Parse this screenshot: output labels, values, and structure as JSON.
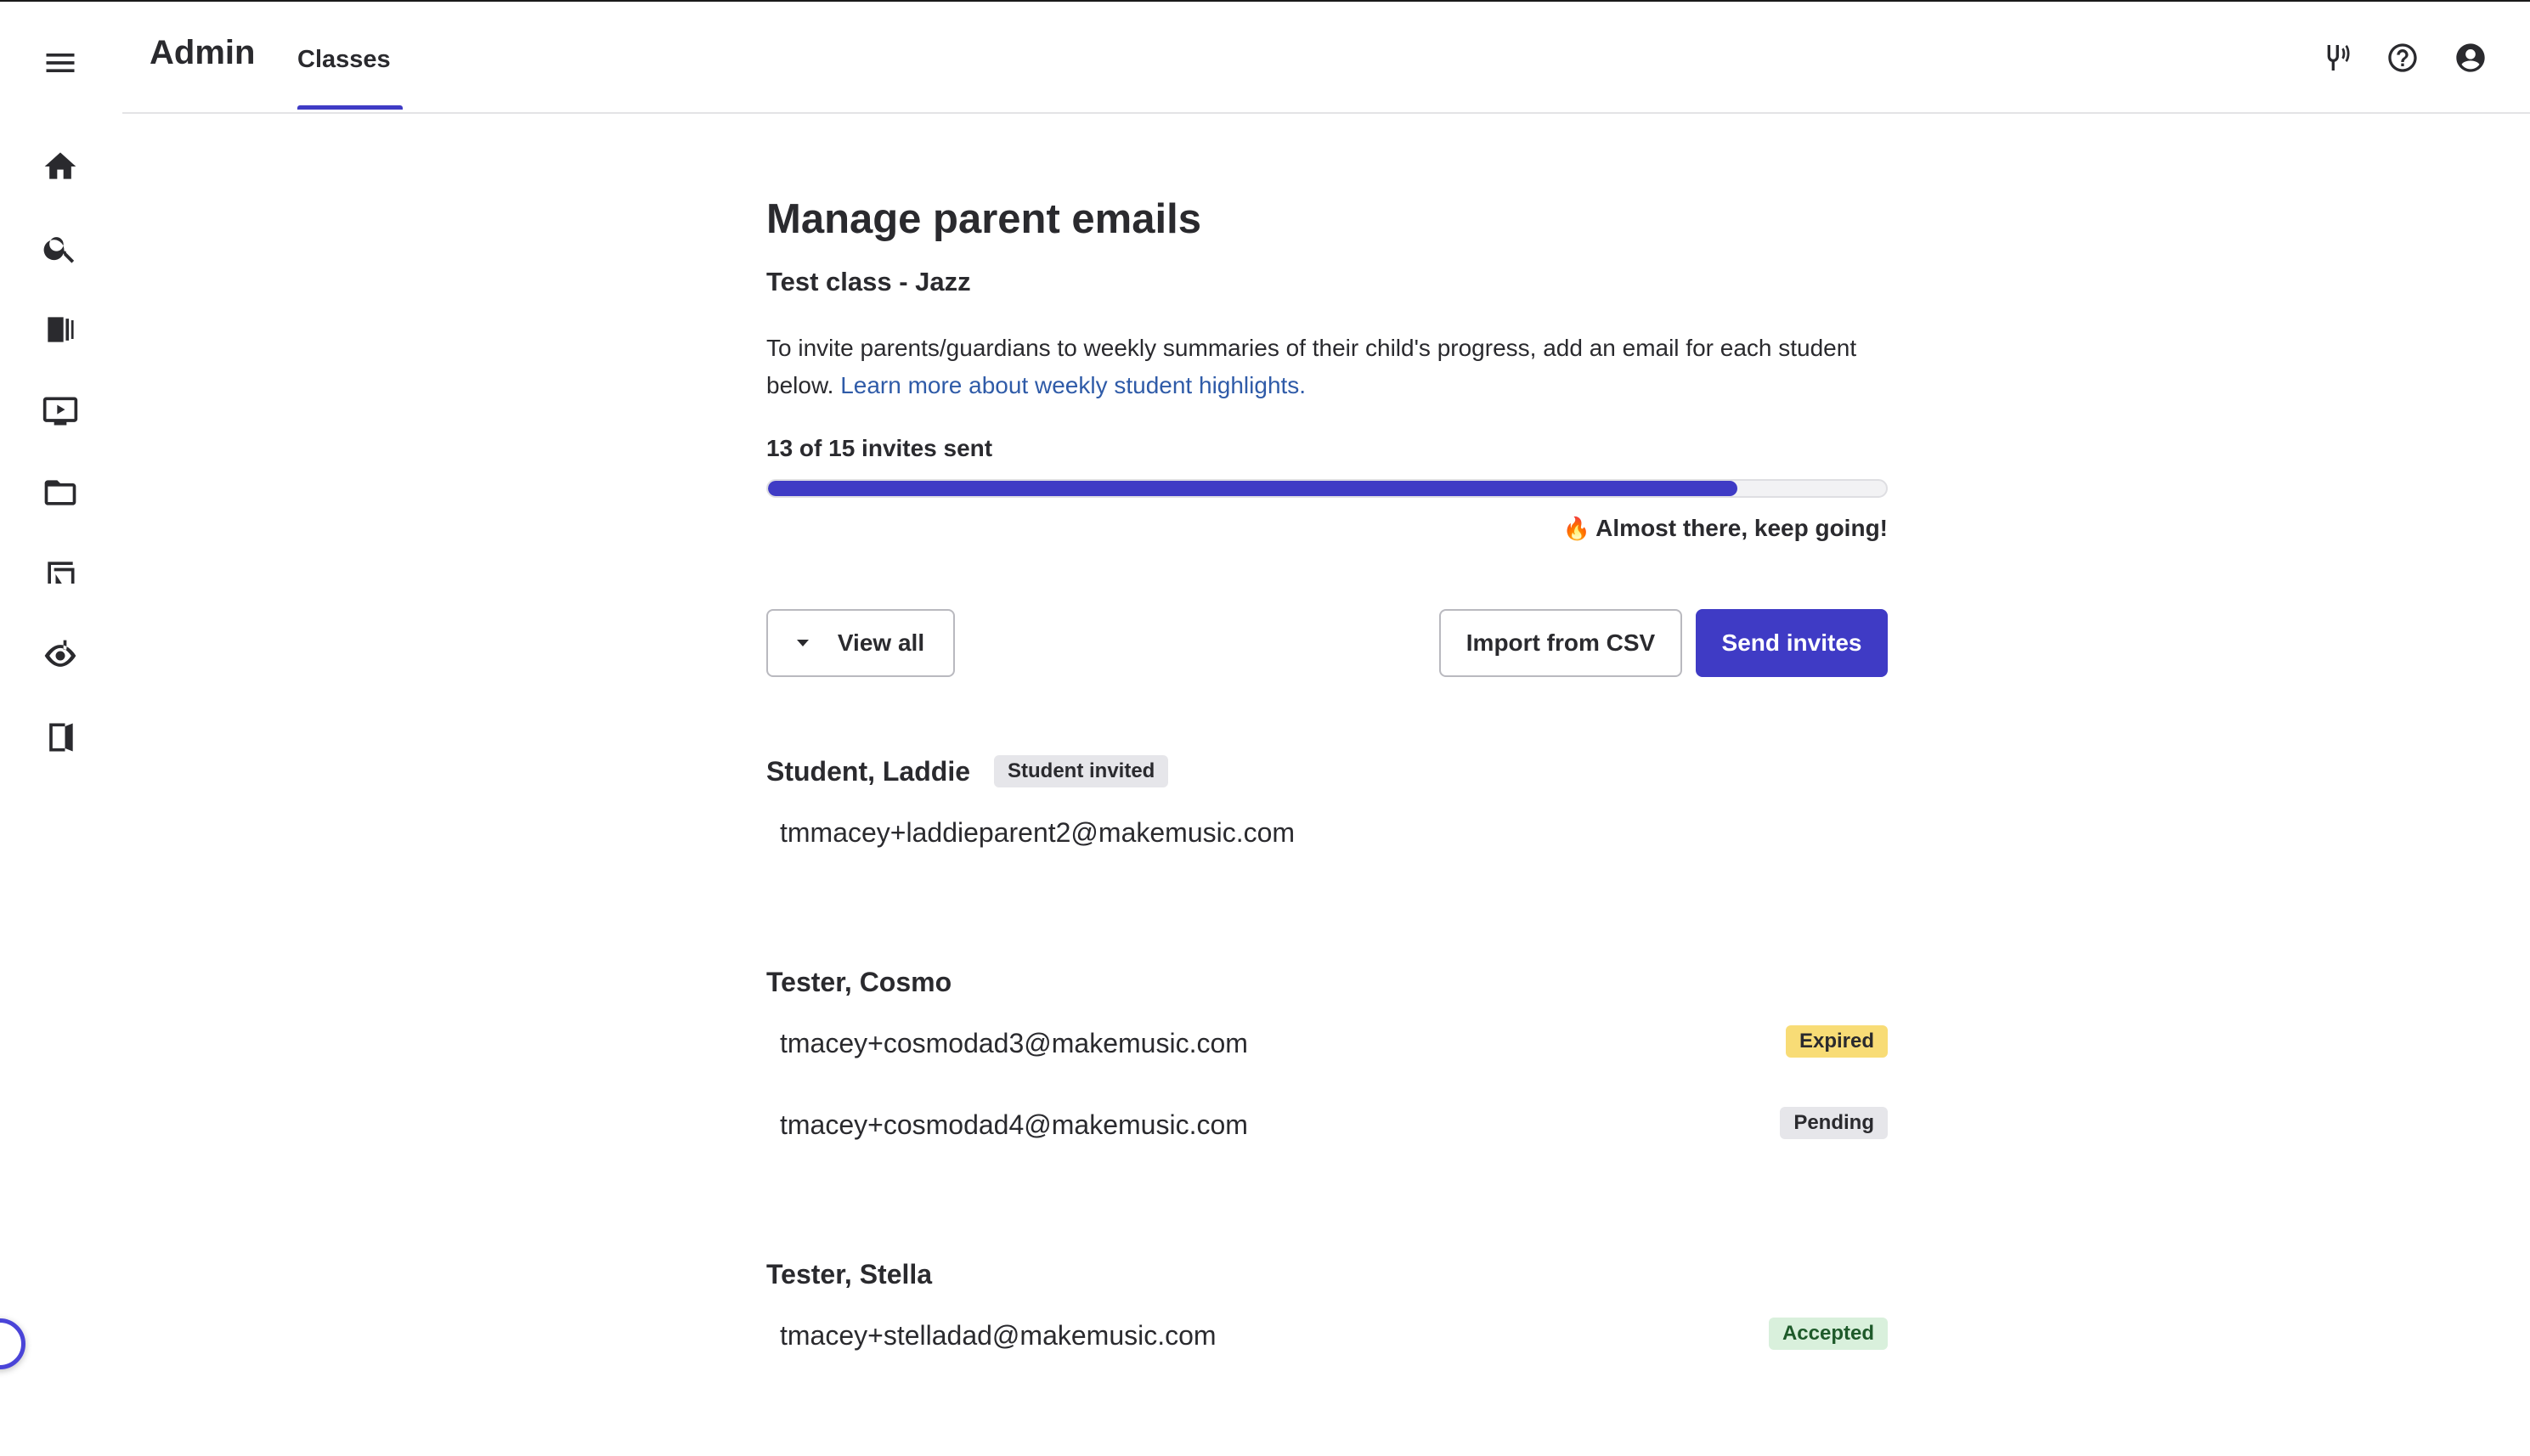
{
  "header": {
    "app_title": "Admin",
    "tabs": [
      {
        "label": "Classes",
        "active": true
      }
    ],
    "icons": [
      "tuning-fork-icon",
      "help-icon",
      "account-icon"
    ]
  },
  "sidebar": {
    "icons": [
      "menu-icon",
      "home-icon",
      "search-icon",
      "library-icon",
      "video-icon",
      "folder-icon",
      "assignment-icon",
      "ear-music-icon",
      "exit-icon"
    ]
  },
  "main": {
    "title": "Manage parent emails",
    "subtitle": "Test class - Jazz",
    "description": "To invite parents/guardians to weekly summaries of their child's progress, add an email for each student below.",
    "learn_more_link": "Learn more about weekly student highlights.",
    "progress": {
      "label": "13 of 15 invites sent",
      "sent": 13,
      "total": 15
    },
    "encouragement": "Almost there, keep going!",
    "view_all_label": "View all",
    "import_label": "Import from CSV",
    "send_label": "Send invites",
    "students": [
      {
        "name": "Student, Laddie",
        "badge": "Student invited",
        "emails": [
          {
            "address": "tmmacey+laddieparent2@makemusic.com",
            "status": ""
          }
        ]
      },
      {
        "name": "Tester, Cosmo",
        "badge": "",
        "emails": [
          {
            "address": "tmacey+cosmodad3@makemusic.com",
            "status": "Expired"
          },
          {
            "address": "tmacey+cosmodad4@makemusic.com",
            "status": "Pending"
          }
        ]
      },
      {
        "name": "Tester, Stella",
        "badge": "",
        "emails": [
          {
            "address": "tmacey+stelladad@makemusic.com",
            "status": "Accepted"
          }
        ]
      }
    ]
  },
  "colors": {
    "accent": "#3f3bc5",
    "link": "#2f5ba8",
    "expired": "#f8dc76",
    "accepted": "#d9f0dc",
    "pending": "#e6e6ea"
  }
}
